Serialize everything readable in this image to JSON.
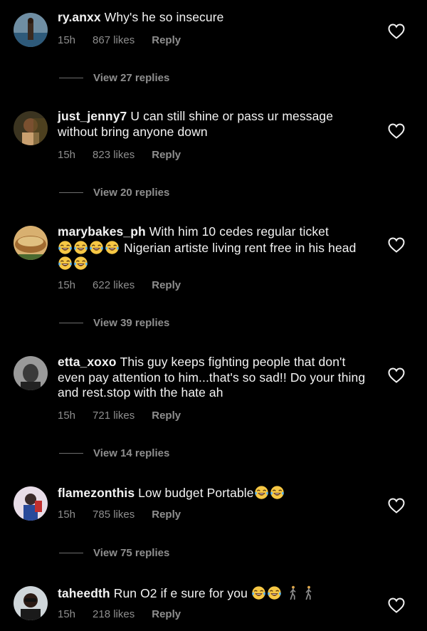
{
  "comments": [
    {
      "username": "ry.anxx",
      "text": "Why's he so insecure",
      "time": "15h",
      "likes": "867 likes",
      "reply": "Reply",
      "view_replies": "View 27 replies"
    },
    {
      "username": "just_jenny7",
      "text": "U can still shine or pass ur message without bring anyone down",
      "time": "15h",
      "likes": "823 likes",
      "reply": "Reply",
      "view_replies": "View 20 replies"
    },
    {
      "username": "marybakes_ph",
      "text_a": "With him 10 cedes regular ticket",
      "text_b": "Nigerian artiste living rent free in his head",
      "time": "15h",
      "likes": "622 likes",
      "reply": "Reply",
      "view_replies": "View 39 replies"
    },
    {
      "username": "etta_xoxo",
      "text": "This guy keeps fighting people that don't even pay attention to him...that's so sad!! Do your thing and rest.stop with the hate ah",
      "time": "15h",
      "likes": "721 likes",
      "reply": "Reply",
      "view_replies": "View 14 replies"
    },
    {
      "username": "flamezonthis",
      "text": "Low budget Portable",
      "time": "15h",
      "likes": "785 likes",
      "reply": "Reply",
      "view_replies": "View 75 replies"
    },
    {
      "username": "taheedth",
      "text": "Run O2  if e sure for you",
      "time": "15h",
      "likes": "218 likes",
      "reply": "Reply"
    }
  ],
  "icons": {
    "like": "heart-outline-icon",
    "laugh": "face-with-tears-of-joy-emoji",
    "walk": "person-walking-emoji"
  },
  "colors": {
    "background": "#000000",
    "text": "#f3f3f3",
    "muted": "#8e8e8e"
  }
}
